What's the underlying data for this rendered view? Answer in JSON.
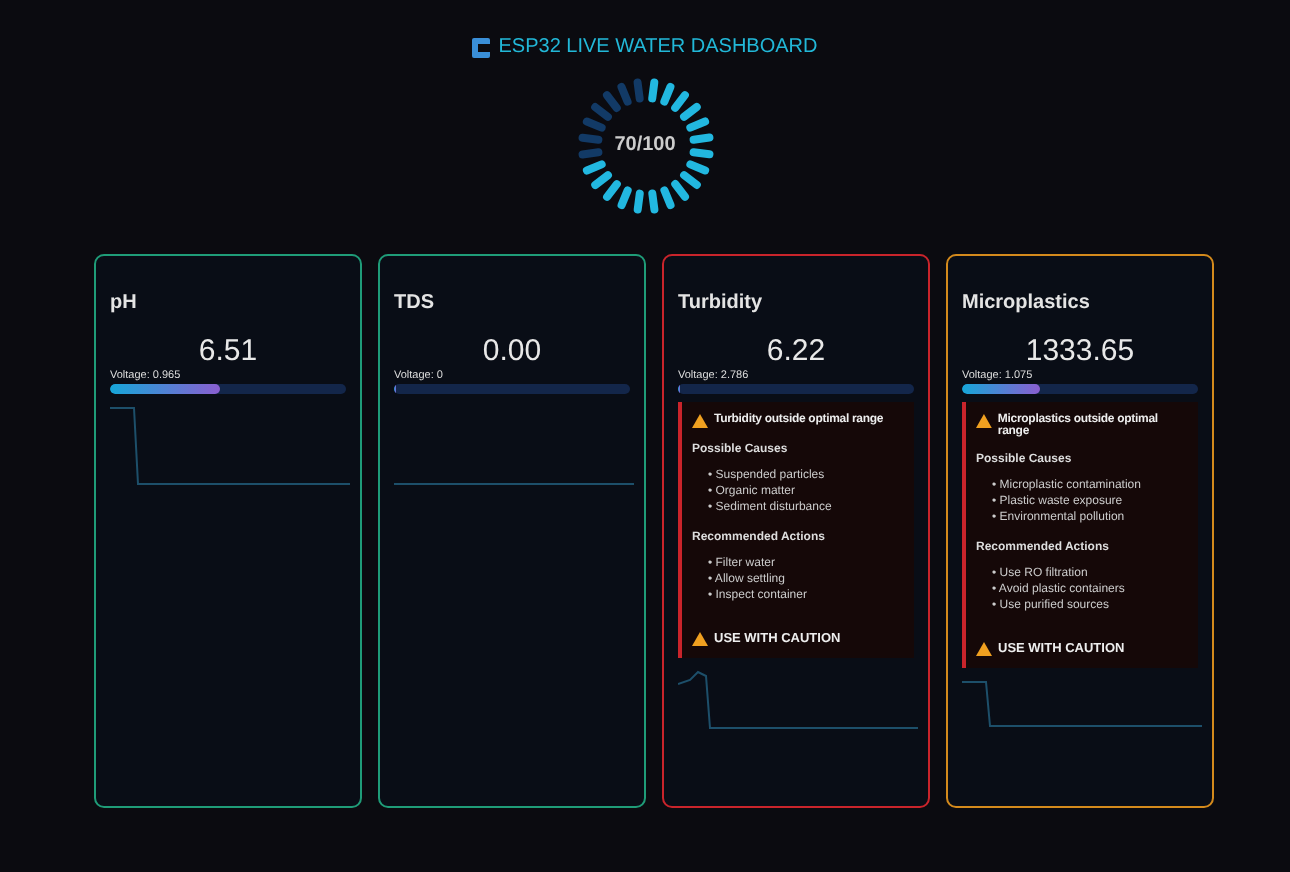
{
  "header": {
    "title": "ESP32 LIVE WATER DASHBOARD"
  },
  "gauge": {
    "reading": "70/100",
    "level": 0.7
  },
  "cards": [
    {
      "title": "pH",
      "value": "6.51",
      "voltage": "Voltage: 0.965",
      "level": 0.47,
      "color": "#1f9c78"
    },
    {
      "title": "TDS",
      "value": "0.00",
      "voltage": "Voltage: 0",
      "level": 0,
      "color": "#1f9c78"
    },
    {
      "title": "Turbidity",
      "value": "6.22",
      "voltage": "Voltage: 2.786",
      "level": 0.01,
      "color": "#c9242b",
      "alert": {
        "title": "Turbidity outside optimal range",
        "causes_heading": "Possible Causes",
        "causes": [
          "• Suspended particles",
          "• Organic matter",
          "• Sediment disturbance"
        ],
        "actions_heading": "Recommended Actions",
        "actions": [
          "• Filter water",
          "• Allow settling",
          "• Inspect container"
        ],
        "verdict": "USE WITH CAUTION"
      }
    },
    {
      "title": "Microplastics",
      "value": "1333.65",
      "voltage": "Voltage: 1.075",
      "level": 0.33,
      "color": "#d48a1c",
      "alert": {
        "title": "Microplastics outside optimal range",
        "causes_heading": "Possible Causes",
        "causes": [
          "• Microplastic contamination",
          "• Plastic waste exposure",
          "• Environmental pollution"
        ],
        "actions_heading": "Recommended Actions",
        "actions": [
          "• Use RO filtration",
          "• Avoid plastic containers",
          "• Use purified sources"
        ],
        "verdict": "USE WITH CAUTION"
      }
    }
  ]
}
